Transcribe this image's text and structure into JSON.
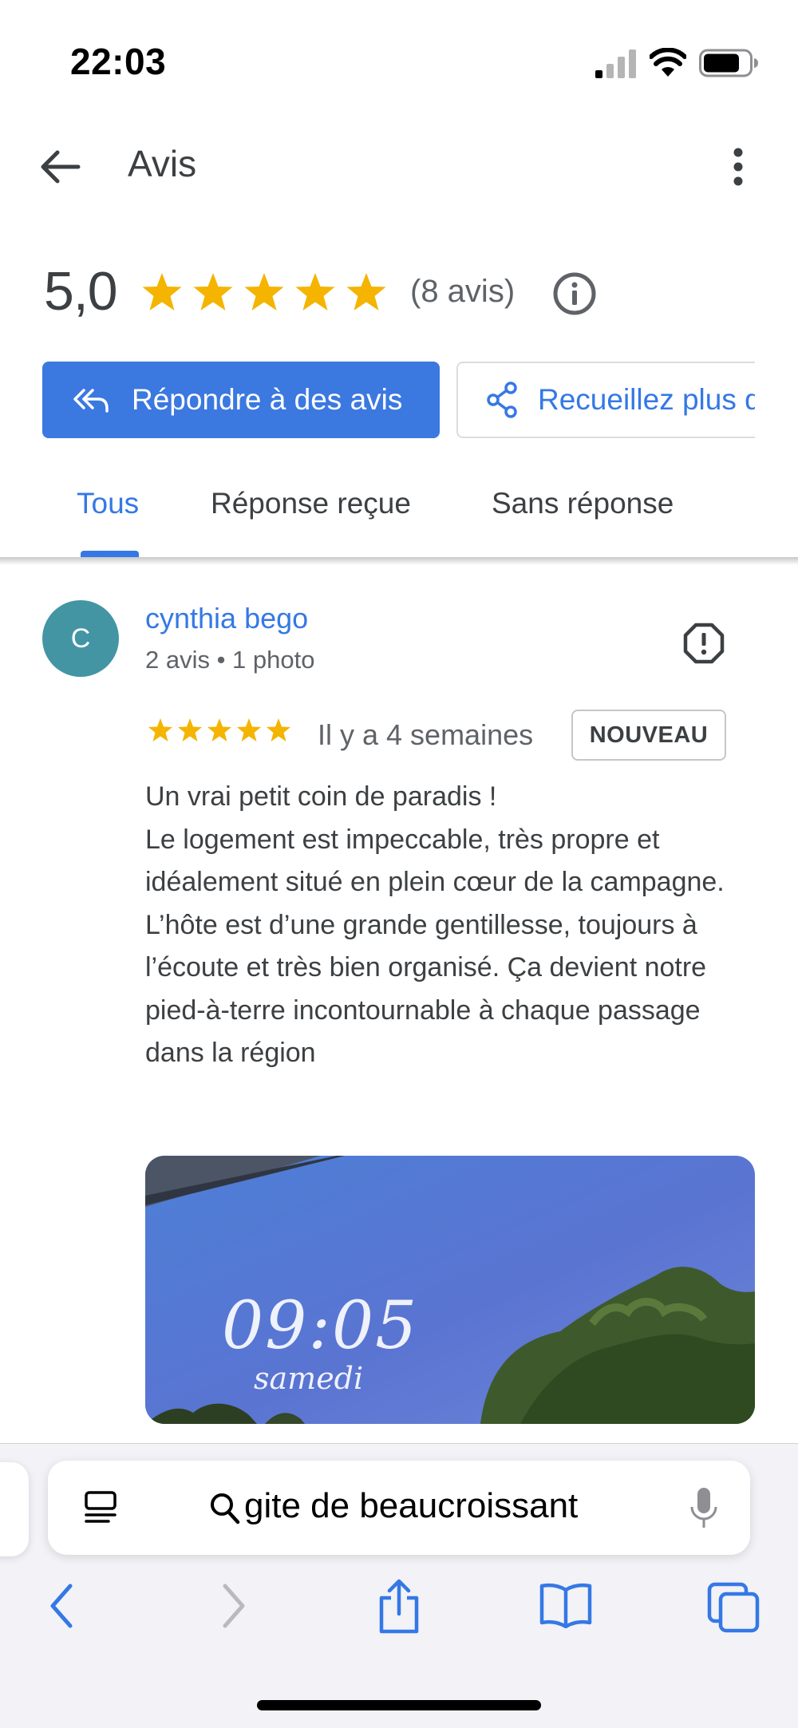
{
  "status_bar": {
    "time": "22:03"
  },
  "header": {
    "title": "Avis",
    "back_icon": "arrow-back-icon",
    "more_icon": "more-vert-icon"
  },
  "summary": {
    "rating": "5,0",
    "stars": 5,
    "review_count": "(8 avis)"
  },
  "actions": {
    "reply_label": "Répondre à des avis",
    "collect_label": "Recueillez plus d'avis"
  },
  "tabs": [
    {
      "label": "Tous",
      "active": true
    },
    {
      "label": "Réponse reçue",
      "active": false
    },
    {
      "label": "Sans réponse",
      "active": false
    }
  ],
  "review": {
    "avatar_letter": "C",
    "reviewer_name": "cynthia bego",
    "reviewer_meta": "2 avis • 1 photo",
    "stars": 5,
    "date": "Il y a 4 semaines",
    "badge": "NOUVEAU",
    "text": "Un vrai petit coin de paradis !\nLe logement est impeccable, très propre et idéalement situé en plein cœur de la campagne. L’hôte est d’une grande gentillesse, toujours à l’écoute et très bien organisé. Ça devient notre pied-à-terre incontournable à chaque passage dans la région",
    "photo_time": "09:05",
    "photo_day": "samedi"
  },
  "browser": {
    "address": "gite de beaucroissant"
  },
  "colors": {
    "accent_blue": "#3578e5",
    "button_blue": "#3b78e0",
    "star_yellow": "#f4b400",
    "avatar_teal": "#4395a4"
  }
}
